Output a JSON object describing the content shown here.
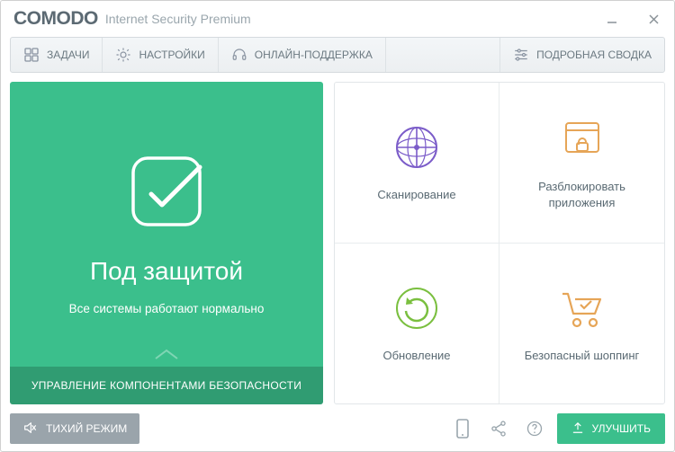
{
  "brand": "COMODO",
  "subtitle": "Internet Security Premium",
  "toolbar": {
    "tasks": "ЗАДАЧИ",
    "settings": "НАСТРОЙКИ",
    "support": "ОНЛАЙН-ПОДДЕРЖКА",
    "summary": "ПОДРОБНАЯ СВОДКА"
  },
  "status": {
    "title": "Под защитой",
    "subtitle": "Все системы работают нормально",
    "footer": "УПРАВЛЕНИЕ КОМПОНЕНТАМИ БЕЗОПАСНОСТИ"
  },
  "tiles": {
    "scan": "Сканирование",
    "unblock": "Разблокировать приложения",
    "update": "Обновление",
    "safeshop": "Безопасный шоппинг"
  },
  "bottom": {
    "silent": "ТИХИЙ РЕЖИМ",
    "upgrade": "УЛУЧШИТЬ"
  },
  "colors": {
    "accent": "#3bbf8c",
    "purple": "#7b5cc9",
    "orange": "#e6a557",
    "green": "#7abf3f"
  }
}
